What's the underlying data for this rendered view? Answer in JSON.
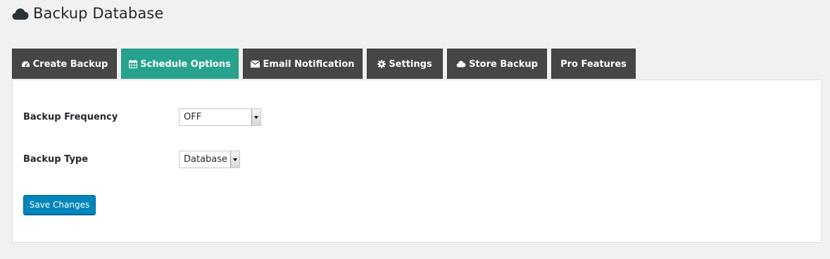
{
  "header": {
    "title": "Backup Database",
    "icon": "cloud-icon"
  },
  "tabs": [
    {
      "label": "Create Backup",
      "icon": "dashboard-icon",
      "active": false
    },
    {
      "label": "Schedule Options",
      "icon": "calendar-icon",
      "active": true
    },
    {
      "label": "Email Notification",
      "icon": "envelope-icon",
      "active": false
    },
    {
      "label": "Settings",
      "icon": "gear-icon",
      "active": false
    },
    {
      "label": "Store Backup",
      "icon": "cloud-icon",
      "active": false
    },
    {
      "label": "Pro Features",
      "icon": "",
      "active": false
    }
  ],
  "form": {
    "frequency": {
      "label": "Backup Frequency",
      "value": "OFF"
    },
    "type": {
      "label": "Backup Type",
      "value": "Database"
    },
    "save_label": "Save Changes"
  },
  "colors": {
    "tab_bg": "#464646",
    "tab_active_bg": "#26a28e",
    "primary_button": "#0085ba",
    "page_bg": "#f1f1f1"
  }
}
